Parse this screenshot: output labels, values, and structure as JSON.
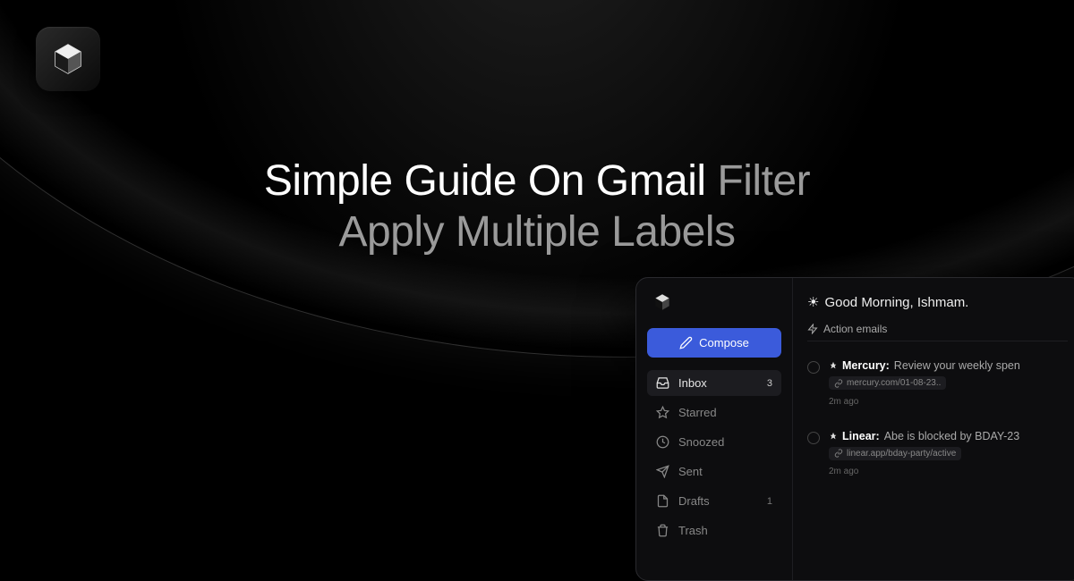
{
  "title": {
    "line1_bright": "Simple Guide On Gmail ",
    "line1_dim": "Filter",
    "line2_dim": "Apply Multiple Labels"
  },
  "app": {
    "compose_label": "Compose",
    "nav": [
      {
        "label": "Inbox",
        "count": "3",
        "icon": "inbox-icon",
        "active": true
      },
      {
        "label": "Starred",
        "count": "",
        "icon": "star-icon",
        "active": false
      },
      {
        "label": "Snoozed",
        "count": "",
        "icon": "clock-icon",
        "active": false
      },
      {
        "label": "Sent",
        "count": "",
        "icon": "send-icon",
        "active": false
      },
      {
        "label": "Drafts",
        "count": "1",
        "icon": "file-icon",
        "active": false
      },
      {
        "label": "Trash",
        "count": "",
        "icon": "trash-icon",
        "active": false
      }
    ],
    "greeting": "Good Morning, Ishmam.",
    "section_label": "Action emails",
    "emails": [
      {
        "sender": "Mercury:",
        "subject": "Review your weekly spen",
        "link": "mercury.com/01-08-23..",
        "time": "2m ago"
      },
      {
        "sender": "Linear:",
        "subject": "Abe is blocked by BDAY-23",
        "link": "linear.app/bday-party/active",
        "time": "2m ago"
      }
    ]
  }
}
